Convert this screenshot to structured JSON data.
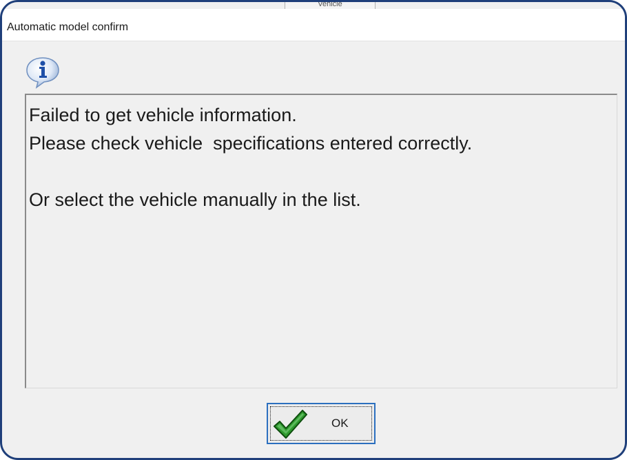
{
  "background_tab": {
    "label": "Vehicle"
  },
  "dialog": {
    "title": "Automatic model confirm",
    "icon": "info-icon",
    "message_lines": [
      "Failed to get vehicle information.",
      "Please check vehicle  specifications entered correctly.",
      "",
      "Or select the vehicle manually in the list."
    ],
    "ok_button": {
      "label": "OK",
      "icon": "checkmark-icon"
    }
  },
  "colors": {
    "window_frame": "#1f3f7a",
    "dialog_background": "#f0f0f0",
    "focus_border": "#2b6fbf",
    "checkmark": "#2e9a2e"
  }
}
